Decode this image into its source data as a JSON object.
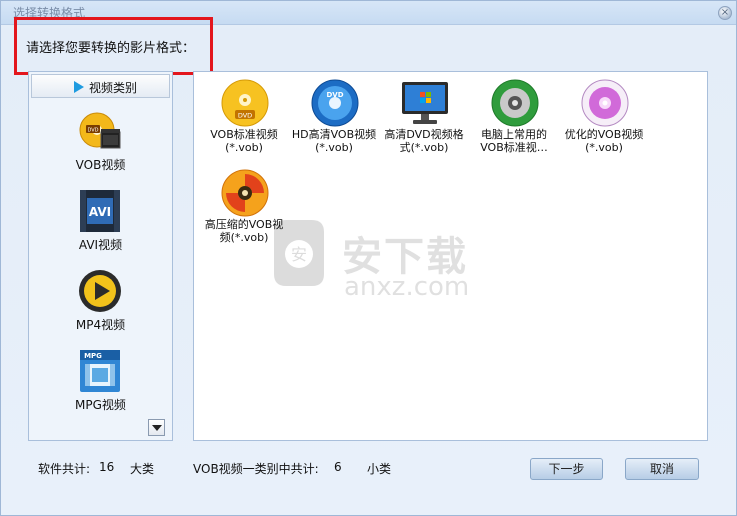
{
  "window": {
    "title": "选择转换格式",
    "close_glyph": "×"
  },
  "prompt": "请选择您要转换的影片格式：",
  "categories": {
    "header_label": "视频类别",
    "items": [
      {
        "label": "VOB视频",
        "icon": "vob-film-icon"
      },
      {
        "label": "AVI视频",
        "icon": "avi-film-icon"
      },
      {
        "label": "MP4视频",
        "icon": "mp4-play-icon"
      },
      {
        "label": "MPG视频",
        "icon": "mpg-film-icon"
      }
    ]
  },
  "formats": [
    {
      "label": "VOB标准视频\n(*.vob)",
      "icon": "dvd-disc-yellow-icon"
    },
    {
      "label": "HD高清VOB视频\n(*.vob)",
      "icon": "dvd-disc-blue-icon"
    },
    {
      "label": "高清DVD视频格\n式(*.vob)",
      "icon": "monitor-icon"
    },
    {
      "label": "电脑上常用的\nVOB标准视…",
      "icon": "disc-green-icon"
    },
    {
      "label": "优化的VOB视频\n(*.vob)",
      "icon": "disc-purple-icon"
    },
    {
      "label": "高压缩的VOB视\n频(*.vob)",
      "icon": "disc-orange-icon"
    }
  ],
  "watermark": {
    "title": "安下载",
    "sub": "anxz.com"
  },
  "footer": {
    "software_total_label": "软件共计:",
    "software_total_value": "16",
    "software_total_unit": "大类",
    "category_label": "VOB视频一类别中共计:",
    "category_value": "6",
    "category_unit": "小类",
    "next_button": "下一步",
    "cancel_button": "取消"
  },
  "colors": {
    "highlight_box": "#e3161d",
    "accent_arrow": "#1e9be0"
  }
}
